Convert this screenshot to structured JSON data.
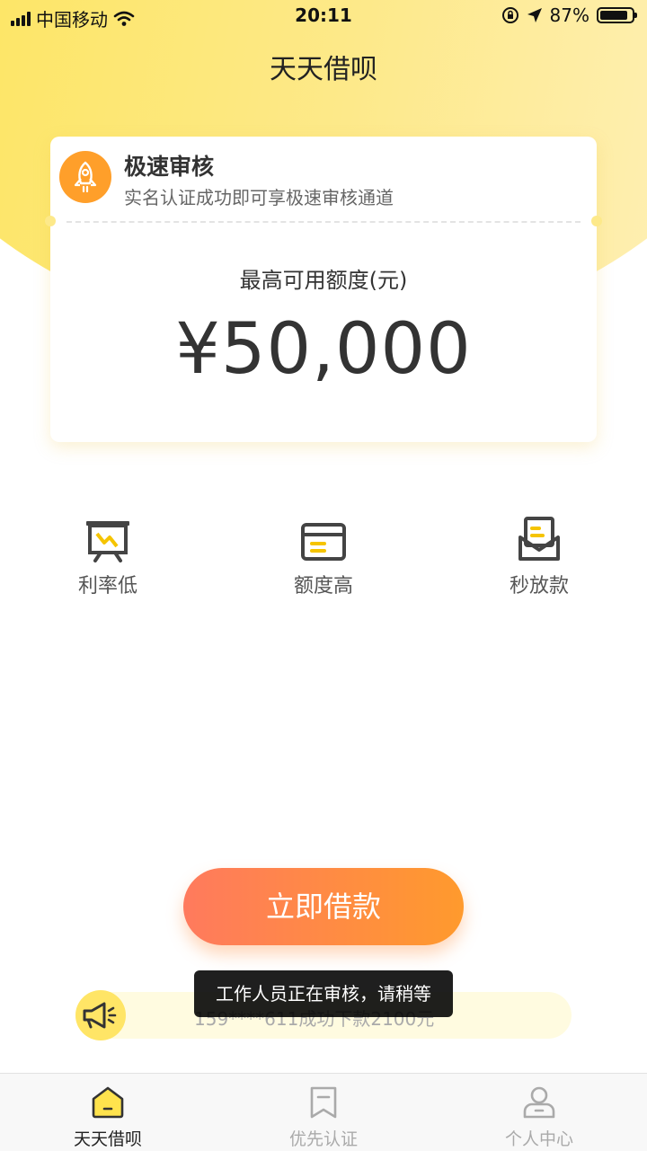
{
  "status_bar": {
    "carrier": "中国移动",
    "time": "20:11",
    "battery_percent": "87%",
    "battery_level": 0.87
  },
  "app": {
    "title": "天天借呗"
  },
  "card": {
    "heading": "极速审核",
    "subheading": "实名认证成功即可享极速审核通道",
    "limit_label": "最高可用额度(元)",
    "limit_amount": "¥50,000"
  },
  "features": [
    {
      "label": "利率低",
      "icon": "easel-chart-icon"
    },
    {
      "label": "额度高",
      "icon": "card-icon"
    },
    {
      "label": "秒放款",
      "icon": "envelope-icon"
    }
  ],
  "cta": {
    "label": "立即借款"
  },
  "ticker": {
    "text": "159****611成功下款2100元",
    "icon": "megaphone-icon"
  },
  "toast": {
    "text": "工作人员正在审核，请稍等"
  },
  "tabs": [
    {
      "label": "天天借呗",
      "icon": "home-icon",
      "active": true
    },
    {
      "label": "优先认证",
      "icon": "bookmark-icon",
      "active": false
    },
    {
      "label": "个人中心",
      "icon": "person-icon",
      "active": false
    }
  ],
  "colors": {
    "accent_yellow": "#fde451",
    "button_start": "#ff7a5d",
    "button_end": "#ff9a2d",
    "orange_badge": "#ff9f2a"
  }
}
